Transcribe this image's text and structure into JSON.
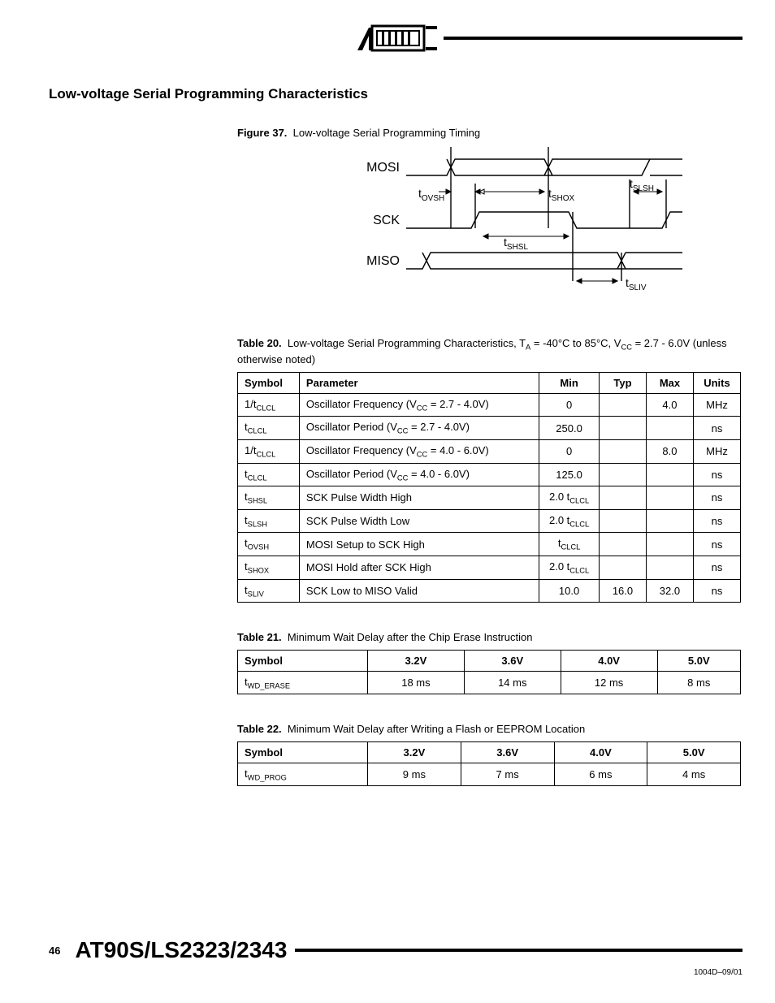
{
  "section_title": "Low-voltage Serial Programming Characteristics",
  "figure37": {
    "label": "Figure 37.",
    "caption": "Low-voltage Serial Programming Timing",
    "signals": {
      "mosi": "MOSI",
      "sck": "SCK",
      "miso": "MISO"
    },
    "timings": {
      "tovsh": "OVSH",
      "tshox": "SHOX",
      "tslsh": "SLSH",
      "tshsl": "SHSL",
      "tsliv": "SLIV"
    }
  },
  "table20": {
    "label": "Table 20.",
    "caption_prefix": "Low-voltage Serial Programming Characteristics, T",
    "caption_mid": " = -40°C to 85°C, V",
    "caption_suffix": " = 2.7 - 6.0V (unless otherwise noted)",
    "headers": [
      "Symbol",
      "Parameter",
      "Min",
      "Typ",
      "Max",
      "Units"
    ],
    "rows": [
      {
        "sym_pre": "1/t",
        "sym_sub": "CLCL",
        "param_pre": "Oscillator Frequency (V",
        "param_sub": "CC",
        "param_suf": " = 2.7 - 4.0V)",
        "min": "0",
        "typ": "",
        "max": "4.0",
        "units": "MHz"
      },
      {
        "sym_pre": "t",
        "sym_sub": "CLCL",
        "param_pre": "Oscillator Period (V",
        "param_sub": "CC",
        "param_suf": " = 2.7 - 4.0V)",
        "min": "250.0",
        "typ": "",
        "max": "",
        "units": "ns"
      },
      {
        "sym_pre": "1/t",
        "sym_sub": "CLCL",
        "param_pre": "Oscillator Frequency (V",
        "param_sub": "CC",
        "param_suf": " = 4.0 - 6.0V)",
        "min": "0",
        "typ": "",
        "max": "8.0",
        "units": "MHz"
      },
      {
        "sym_pre": "t",
        "sym_sub": "CLCL",
        "param_pre": "Oscillator Period (V",
        "param_sub": "CC",
        "param_suf": " = 4.0 - 6.0V)",
        "min": "125.0",
        "typ": "",
        "max": "",
        "units": "ns"
      },
      {
        "sym_pre": "t",
        "sym_sub": "SHSL",
        "param_plain": "SCK Pulse Width High",
        "min_pre": "2.0 t",
        "min_sub": "CLCL",
        "typ": "",
        "max": "",
        "units": "ns"
      },
      {
        "sym_pre": "t",
        "sym_sub": "SLSH",
        "param_plain": "SCK Pulse Width Low",
        "min_pre": "2.0 t",
        "min_sub": "CLCL",
        "typ": "",
        "max": "",
        "units": "ns"
      },
      {
        "sym_pre": "t",
        "sym_sub": "OVSH",
        "param_plain": "MOSI Setup to SCK High",
        "min_pre": "t",
        "min_sub": "CLCL",
        "typ": "",
        "max": "",
        "units": "ns"
      },
      {
        "sym_pre": "t",
        "sym_sub": "SHOX",
        "param_plain": "MOSI Hold after SCK High",
        "min_pre": "2.0 t",
        "min_sub": "CLCL",
        "typ": "",
        "max": "",
        "units": "ns"
      },
      {
        "sym_pre": "t",
        "sym_sub": "SLIV",
        "param_plain": "SCK Low to MISO Valid",
        "min": "10.0",
        "typ": "16.0",
        "max": "32.0",
        "units": "ns"
      }
    ]
  },
  "table21": {
    "label": "Table 21.",
    "caption": "Minimum Wait Delay after the Chip Erase Instruction",
    "headers": [
      "Symbol",
      "3.2V",
      "3.6V",
      "4.0V",
      "5.0V"
    ],
    "row": {
      "sym_pre": "t",
      "sym_sub": "WD_ERASE",
      "v32": "18 ms",
      "v36": "14 ms",
      "v40": "12 ms",
      "v50": "8 ms"
    }
  },
  "table22": {
    "label": "Table 22.",
    "caption": "Minimum Wait Delay after Writing a Flash or EEPROM Location",
    "headers": [
      "Symbol",
      "3.2V",
      "3.6V",
      "4.0V",
      "5.0V"
    ],
    "row": {
      "sym_pre": "t",
      "sym_sub": "WD_PROG",
      "v32": "9 ms",
      "v36": "7 ms",
      "v40": "6 ms",
      "v50": "4 ms"
    }
  },
  "footer": {
    "page": "46",
    "device": "AT90S/LS2323/2343",
    "doccode": "1004D–09/01"
  }
}
